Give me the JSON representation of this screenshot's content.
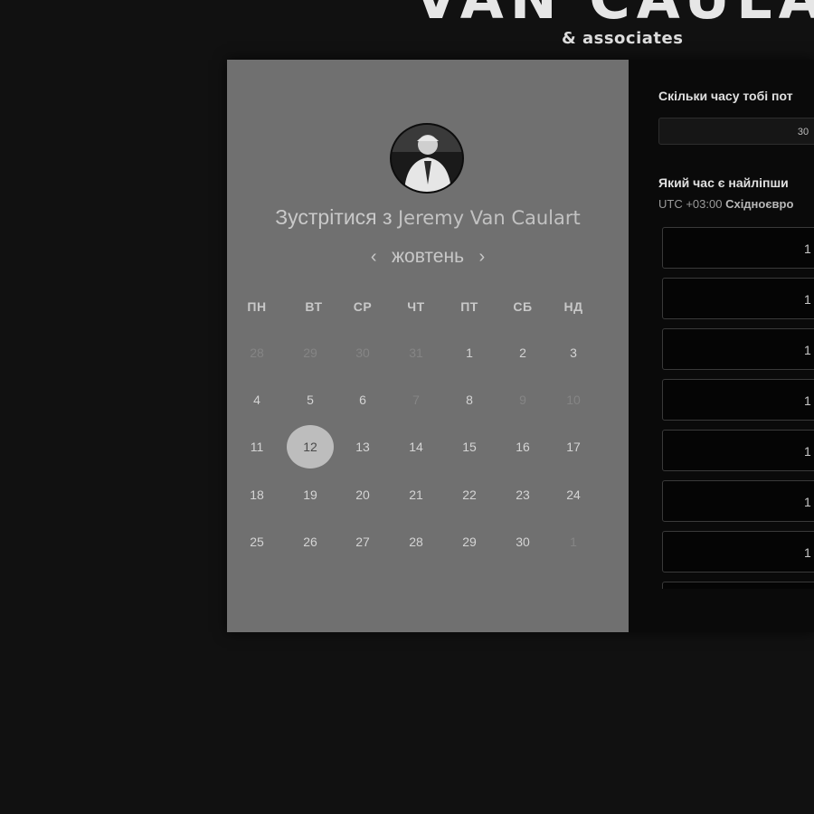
{
  "brand": {
    "title": "VAN CAULART",
    "subtitle": "& associates"
  },
  "booking": {
    "meet_prefix": "Зустрітися з",
    "host_name": "Jeremy Van Caulart",
    "month": "жовтень",
    "prev_arrow": "‹",
    "next_arrow": "›",
    "weekdays": [
      "ПН",
      "ВТ",
      "СР",
      "ЧТ",
      "ПТ",
      "СБ",
      "НД"
    ],
    "weeks": [
      [
        {
          "d": "28",
          "m": true
        },
        {
          "d": "29",
          "m": true
        },
        {
          "d": "30",
          "m": true
        },
        {
          "d": "31",
          "m": true
        },
        {
          "d": "1"
        },
        {
          "d": "2"
        },
        {
          "d": "3"
        }
      ],
      [
        {
          "d": "4"
        },
        {
          "d": "5"
        },
        {
          "d": "6"
        },
        {
          "d": "7",
          "m": true
        },
        {
          "d": "8"
        },
        {
          "d": "9",
          "m": true
        },
        {
          "d": "10",
          "m": true
        }
      ],
      [
        {
          "d": "11"
        },
        {
          "d": "12",
          "s": true
        },
        {
          "d": "13"
        },
        {
          "d": "14"
        },
        {
          "d": "15"
        },
        {
          "d": "16"
        },
        {
          "d": "17"
        }
      ],
      [
        {
          "d": "18"
        },
        {
          "d": "19"
        },
        {
          "d": "20"
        },
        {
          "d": "21"
        },
        {
          "d": "22"
        },
        {
          "d": "23"
        },
        {
          "d": "24"
        }
      ],
      [
        {
          "d": "25"
        },
        {
          "d": "26"
        },
        {
          "d": "27"
        },
        {
          "d": "28"
        },
        {
          "d": "29"
        },
        {
          "d": "30"
        },
        {
          "d": "1",
          "m": true
        }
      ]
    ],
    "selected_day": "12"
  },
  "panel": {
    "duration_question": "Скільки часу тобі пот",
    "duration_value": "30",
    "time_question": "Який час є найліпши",
    "tz_offset": "UTC +03:00",
    "tz_name": "Східноєвро",
    "slots": [
      "1",
      "1",
      "1",
      "1",
      "1",
      "1",
      "1",
      ""
    ]
  },
  "colors": {
    "background": "#111111",
    "calendar_panel": "#707070",
    "right_panel": "#0a0a0a",
    "selected_day": "#bdbdbd"
  }
}
